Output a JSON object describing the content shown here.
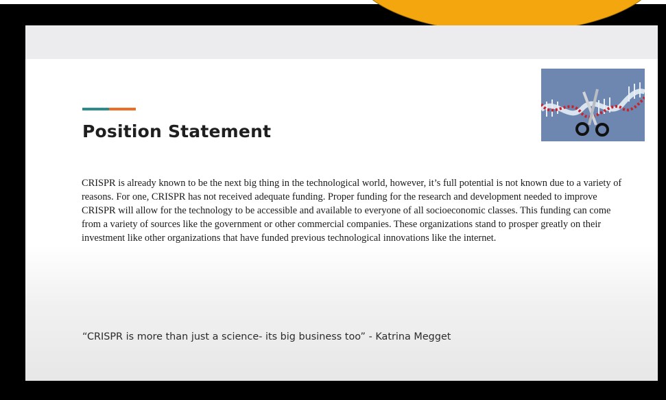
{
  "slide": {
    "title": "Position Statement",
    "body": "CRISPR is already known to be the next big thing in the technological world, however, it’s full potential is not known due to a variety of reasons. For one, CRISPR has not received adequate funding.  Proper funding for the research and development needed to improve CRISPR will allow for the technology to be accessible and available to everyone of all socioeconomic classes. This funding can come from a variety of sources like the government or other commercial companies. These organizations stand to prosper greatly on their investment like other organizations that have funded previous technological innovations like the internet.",
    "quote": "“CRISPR is more than just a science- its big business too” - Katrina Megget",
    "image_icon": "dna-scissors-icon"
  },
  "colors": {
    "accent_teal": "#2d8b8b",
    "accent_orange": "#ec6d26",
    "bubble": "#f4a60f",
    "image_bg": "#6d87b0"
  }
}
